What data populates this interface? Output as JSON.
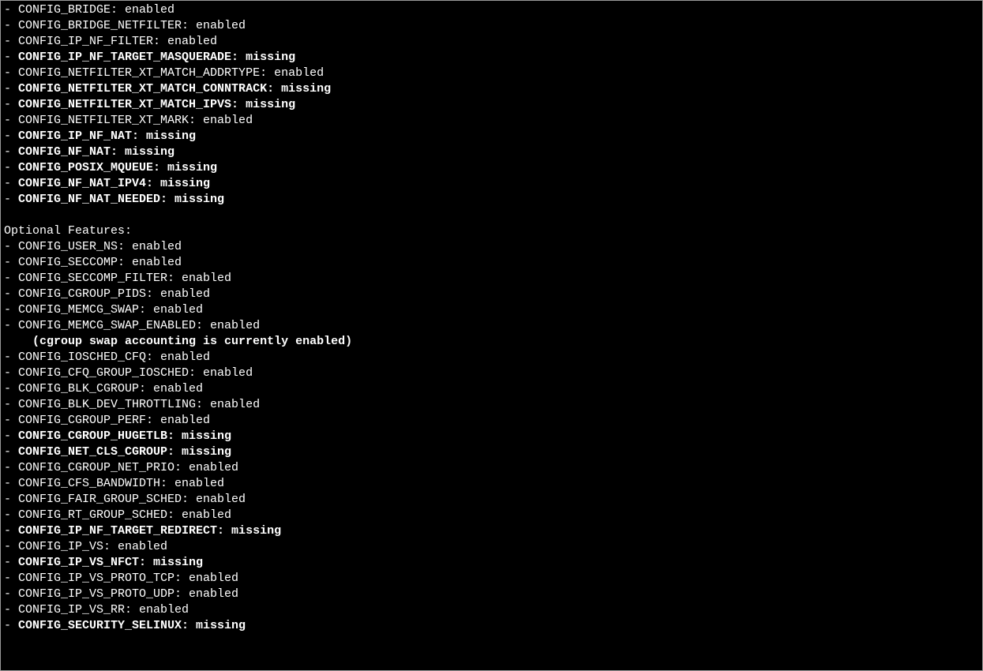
{
  "terminal": {
    "bullet": "- ",
    "indent": "    ",
    "lines": [
      {
        "type": "item",
        "text": "CONFIG_BRIDGE: enabled",
        "bold": false
      },
      {
        "type": "item",
        "text": "CONFIG_BRIDGE_NETFILTER: enabled",
        "bold": false
      },
      {
        "type": "item",
        "text": "CONFIG_IP_NF_FILTER: enabled",
        "bold": false
      },
      {
        "type": "item",
        "text": "CONFIG_IP_NF_TARGET_MASQUERADE: missing",
        "bold": true
      },
      {
        "type": "item",
        "text": "CONFIG_NETFILTER_XT_MATCH_ADDRTYPE: enabled",
        "bold": false
      },
      {
        "type": "item",
        "text": "CONFIG_NETFILTER_XT_MATCH_CONNTRACK: missing",
        "bold": true
      },
      {
        "type": "item",
        "text": "CONFIG_NETFILTER_XT_MATCH_IPVS: missing",
        "bold": true
      },
      {
        "type": "item",
        "text": "CONFIG_NETFILTER_XT_MARK: enabled",
        "bold": false
      },
      {
        "type": "item",
        "text": "CONFIG_IP_NF_NAT: missing",
        "bold": true
      },
      {
        "type": "item",
        "text": "CONFIG_NF_NAT: missing",
        "bold": true
      },
      {
        "type": "item",
        "text": "CONFIG_POSIX_MQUEUE: missing",
        "bold": true
      },
      {
        "type": "item",
        "text": "CONFIG_NF_NAT_IPV4: missing",
        "bold": true
      },
      {
        "type": "item",
        "text": "CONFIG_NF_NAT_NEEDED: missing",
        "bold": true
      },
      {
        "type": "blank"
      },
      {
        "type": "heading",
        "text": "Optional Features:",
        "bold": false
      },
      {
        "type": "item",
        "text": "CONFIG_USER_NS: enabled",
        "bold": false
      },
      {
        "type": "item",
        "text": "CONFIG_SECCOMP: enabled",
        "bold": false
      },
      {
        "type": "item",
        "text": "CONFIG_SECCOMP_FILTER: enabled",
        "bold": false
      },
      {
        "type": "item",
        "text": "CONFIG_CGROUP_PIDS: enabled",
        "bold": false
      },
      {
        "type": "item",
        "text": "CONFIG_MEMCG_SWAP: enabled",
        "bold": false
      },
      {
        "type": "item",
        "text": "CONFIG_MEMCG_SWAP_ENABLED: enabled",
        "bold": false
      },
      {
        "type": "indent",
        "text": "(cgroup swap accounting is currently enabled)",
        "bold": true
      },
      {
        "type": "item",
        "text": "CONFIG_IOSCHED_CFQ: enabled",
        "bold": false
      },
      {
        "type": "item",
        "text": "CONFIG_CFQ_GROUP_IOSCHED: enabled",
        "bold": false
      },
      {
        "type": "item",
        "text": "CONFIG_BLK_CGROUP: enabled",
        "bold": false
      },
      {
        "type": "item",
        "text": "CONFIG_BLK_DEV_THROTTLING: enabled",
        "bold": false
      },
      {
        "type": "item",
        "text": "CONFIG_CGROUP_PERF: enabled",
        "bold": false
      },
      {
        "type": "item",
        "text": "CONFIG_CGROUP_HUGETLB: missing",
        "bold": true
      },
      {
        "type": "item",
        "text": "CONFIG_NET_CLS_CGROUP: missing",
        "bold": true
      },
      {
        "type": "item",
        "text": "CONFIG_CGROUP_NET_PRIO: enabled",
        "bold": false
      },
      {
        "type": "item",
        "text": "CONFIG_CFS_BANDWIDTH: enabled",
        "bold": false
      },
      {
        "type": "item",
        "text": "CONFIG_FAIR_GROUP_SCHED: enabled",
        "bold": false
      },
      {
        "type": "item",
        "text": "CONFIG_RT_GROUP_SCHED: enabled",
        "bold": false
      },
      {
        "type": "item",
        "text": "CONFIG_IP_NF_TARGET_REDIRECT: missing",
        "bold": true
      },
      {
        "type": "item",
        "text": "CONFIG_IP_VS: enabled",
        "bold": false
      },
      {
        "type": "item",
        "text": "CONFIG_IP_VS_NFCT: missing",
        "bold": true
      },
      {
        "type": "item",
        "text": "CONFIG_IP_VS_PROTO_TCP: enabled",
        "bold": false
      },
      {
        "type": "item",
        "text": "CONFIG_IP_VS_PROTO_UDP: enabled",
        "bold": false
      },
      {
        "type": "item",
        "text": "CONFIG_IP_VS_RR: enabled",
        "bold": false
      },
      {
        "type": "item",
        "text": "CONFIG_SECURITY_SELINUX: missing",
        "bold": true
      }
    ]
  }
}
